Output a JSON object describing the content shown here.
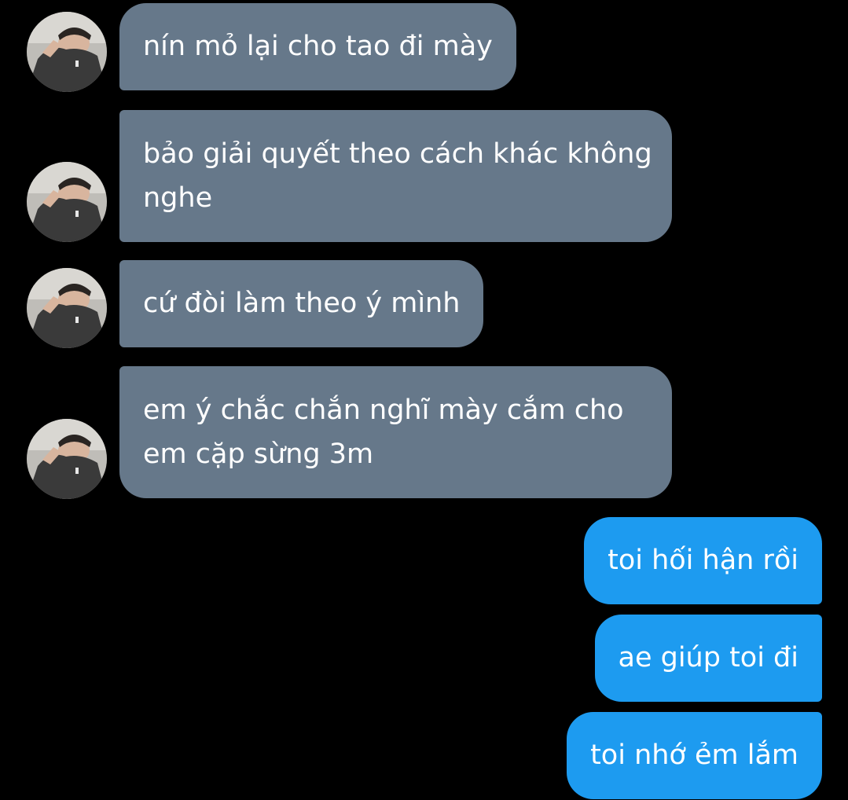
{
  "conversation": {
    "incoming": [
      {
        "lines": [
          "nín mỏ lại cho tao đi mày"
        ]
      },
      {
        "lines": [
          "bảo giải quyết theo cách khác không",
          "nghe"
        ]
      },
      {
        "lines": [
          "cứ đòi làm theo ý mình"
        ]
      },
      {
        "lines": [
          "em ý chắc chắn nghĩ mày cắm cho",
          "em cặp sừng 3m"
        ]
      }
    ],
    "outgoing": [
      {
        "lines": [
          "toi hối hận rồi"
        ]
      },
      {
        "lines": [
          "ae giúp toi đi"
        ]
      },
      {
        "lines": [
          "toi nhớ ẻm lắm"
        ]
      }
    ]
  },
  "colors": {
    "background": "#000000",
    "incoming_bubble": "#66788a",
    "outgoing_bubble": "#1d9bf0",
    "text": "#ffffff"
  },
  "icons": {
    "avatar": "user-photo-avatar"
  }
}
